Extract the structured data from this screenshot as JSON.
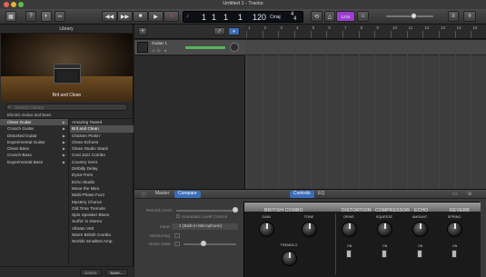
{
  "window": {
    "title": "Untitled 1 - Tracks"
  },
  "colors": {
    "accent": "#3b6db8",
    "record": "#d33a3a",
    "level_green": "#56b85a",
    "tuner_purple": "#9b3fcf"
  },
  "toolbar": {
    "library_icon": "library-icon",
    "help_icon": "help-icon",
    "smart_controls_icon": "smart-controls-icon",
    "editors_icon": "scissors-icon",
    "transport": [
      "rewind-icon",
      "fast-forward-icon",
      "stop-icon",
      "play-icon",
      "record-icon"
    ],
    "lcd": {
      "bar": "1",
      "beat": "1",
      "bar_sub": "1",
      "beat_sub": "1",
      "tempo": "120",
      "key": "Cmaj",
      "time_sig_top": "4",
      "time_sig_bottom": "4"
    },
    "tuner_label": "1234",
    "master_volume_level": 0.6
  },
  "library": {
    "header": "Library",
    "preview_caption": "Brit and Clean",
    "search_placeholder": "Search Library",
    "breadcrumb": "Electric Guitar and Bass",
    "categories": [
      "Clean Guitar",
      "Crunch Guitar",
      "Distorted Guitar",
      "Experimental Guitar",
      "Clean Bass",
      "Crunch Bass",
      "Experimental Bass"
    ],
    "selected_category_index": 0,
    "patches": [
      "Amazing Tweed",
      "Brit and Clean",
      "Chicken Pickin'",
      "Clean Echoes",
      "Clean Studio Stack",
      "Cool Jazz Combo",
      "Country Gent",
      "Dirtbilly Delay",
      "Dyna-Trem",
      "Echo Studio",
      "Move the Mics",
      "Multi-Phase Fuzz",
      "Mystery Chorus",
      "Old Time Tremolo",
      "Spin Speaker Blues",
      "Surfin' in Stereo",
      "Vibrato Vett",
      "Warm British Combo",
      "Worlds Smallest Amp"
    ],
    "selected_patch_index": 1,
    "delete_label": "Delete",
    "save_label": "Save..."
  },
  "tracks": {
    "add_label": "+",
    "track_name": "Guitar 1",
    "ruler_numbers": [
      "1",
      "2",
      "3",
      "4",
      "5",
      "6",
      "7",
      "8",
      "9",
      "10",
      "11",
      "12",
      "13",
      "14",
      "15"
    ]
  },
  "smart_controls": {
    "info_icon": "info-icon",
    "master_label": "Master",
    "compare_label": "Compare",
    "controls_label": "Controls",
    "eq_label": "EQ",
    "record_level_label": "Record Level:",
    "auto_level_label": "Automatic Level Control",
    "input_label": "Input:",
    "input_value": "1 (Built-in Microphone)",
    "monitoring_label": "Monitoring:",
    "noise_gate_label": "Noise Gate:",
    "noise_gate_checked": true,
    "amp": {
      "british_combo": "BRITISH COMBO",
      "distortion": "DISTORTION",
      "compressor": "COMPRESSOR",
      "echo": "ECHO",
      "reverb": "REVERB",
      "gain": "GAIN",
      "tone": "TONE",
      "tremolo": "TREMOLO",
      "drive": "DRIVE",
      "squeeze": "SQUEEZE",
      "amount": "AMOUNT",
      "spring": "SPRING",
      "on": "ON"
    }
  }
}
